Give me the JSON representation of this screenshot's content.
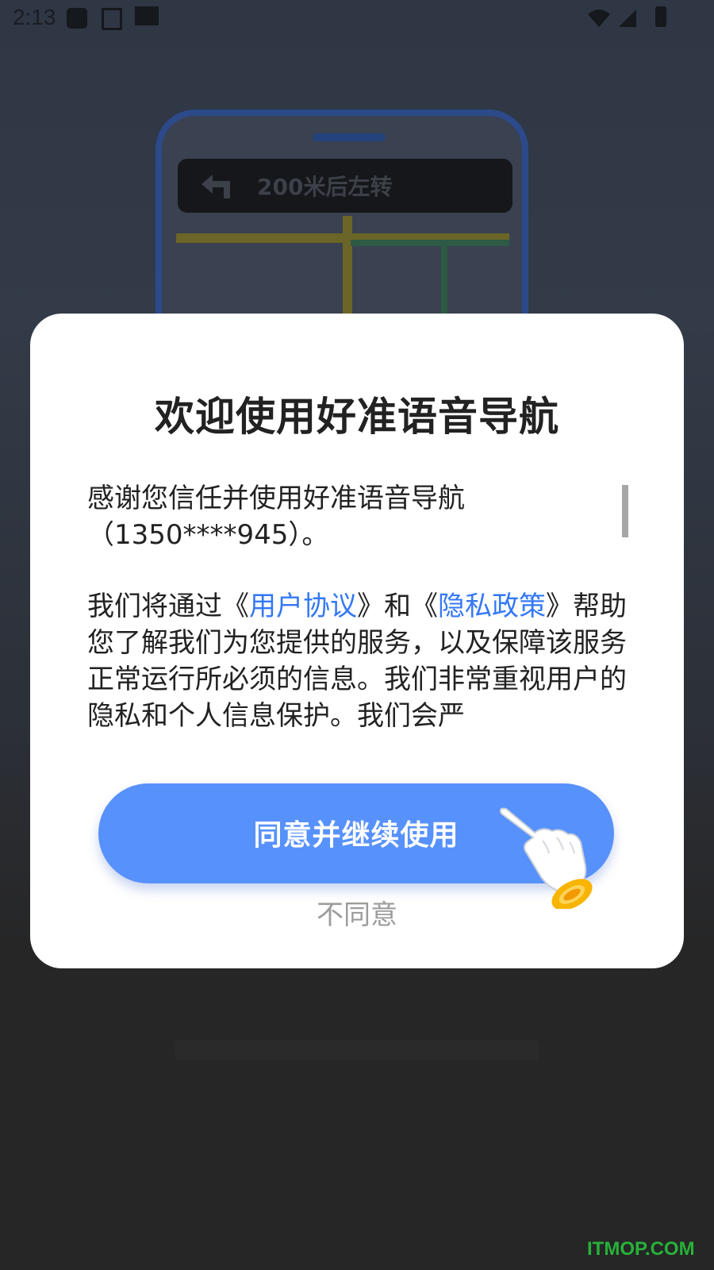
{
  "status_bar": {
    "time": "2:13"
  },
  "background": {
    "nav_banner_text": "200米后左转"
  },
  "dialog": {
    "title": "欢迎使用好准语音导航",
    "paragraph1": "感谢您信任并使用好准语音导航（1350****945）。",
    "paragraph2": {
      "before_link1": "我们将通过《",
      "link1": "用户协议",
      "between_links": "》和《",
      "link2": "隐私政策",
      "after_link2": "》帮助您了解我们为您提供的服务，以及保障该服务正常运行所必须的信息。我们非常重视用户的隐私和个人信息保护。我们会严"
    },
    "agree_button_label": "同意并继续使用",
    "disagree_label": "不同意"
  },
  "watermark": "ITMOP.COM",
  "colors": {
    "accent": "#5791fc",
    "link": "#3478f6",
    "overlay": "#262626"
  }
}
